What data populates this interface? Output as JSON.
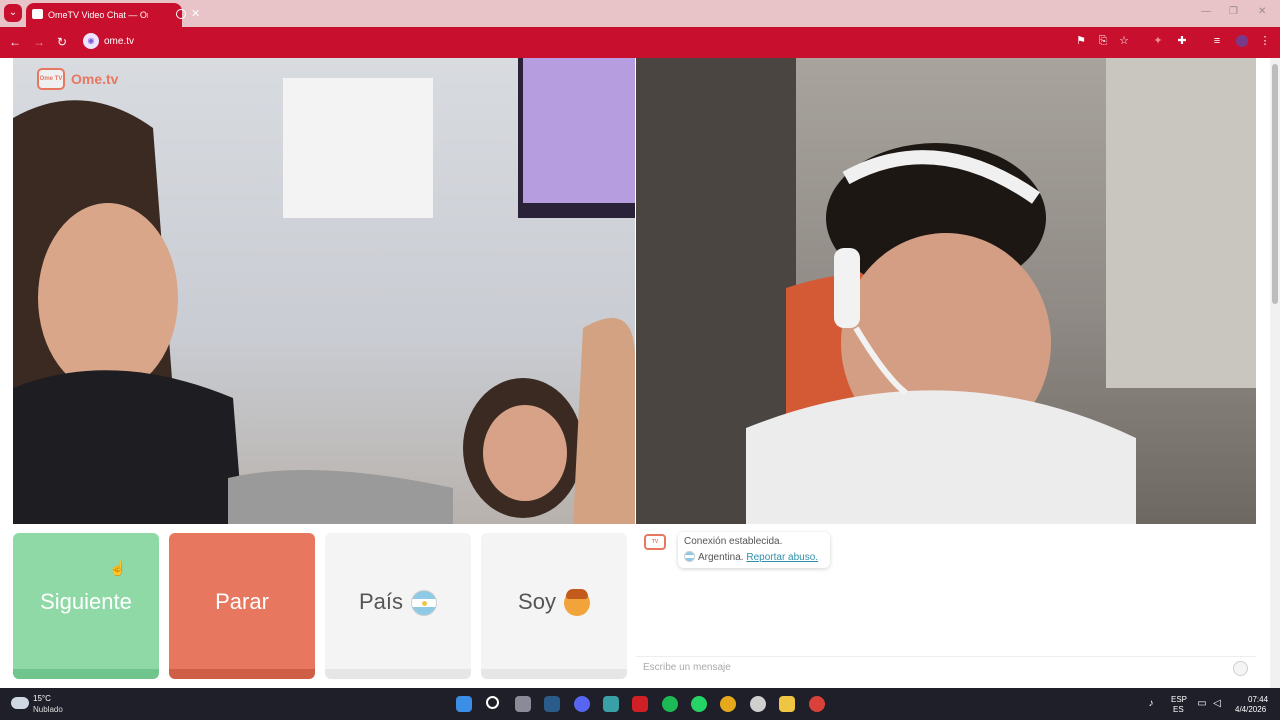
{
  "browser": {
    "tab_title": "OmeTV Video Chat — Ome",
    "url": "ome.tv"
  },
  "site": {
    "logo_text": "Ome.tv",
    "logo_badge": "Ome TV"
  },
  "buttons": {
    "next": "Siguiente",
    "stop": "Parar",
    "country": "País",
    "gender": "Soy"
  },
  "chat": {
    "status": "Conexión establecida.",
    "country": "Argentina.",
    "report": "Reportar abuso.",
    "input_placeholder": "Escribe un mensaje"
  },
  "taskbar": {
    "temperature": "15°C",
    "condition": "Nublado",
    "lang_top": "ESP",
    "lang_bottom": "ES",
    "time": "07:44",
    "date": "4/4/2026"
  }
}
